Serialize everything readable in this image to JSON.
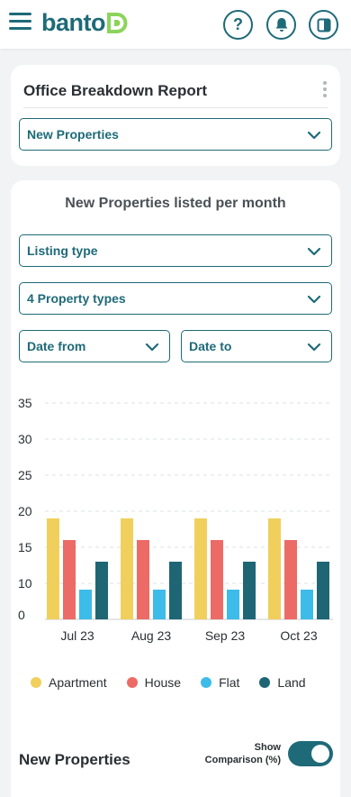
{
  "app": {
    "logo_text": "banto",
    "logo_mark": "D"
  },
  "header": {
    "help_label": "?"
  },
  "report_card": {
    "title": "Office Breakdown Report",
    "report_select": "New Properties"
  },
  "chart_card": {
    "title": "New Properties listed per month",
    "filters": {
      "listing_type": "Listing type",
      "property_types": "4 Property types",
      "date_from": "Date from",
      "date_to": "Date to"
    },
    "section_title": "New Properties",
    "toggle_label_line1": "Show",
    "toggle_label_line2": "Comparison (%)",
    "toggle_on": true
  },
  "colors": {
    "brand": "#1e6a78",
    "apartment": "#f1cf5c",
    "house": "#ec6b66",
    "flat": "#3dbbe9",
    "land": "#1f6675"
  },
  "chart_data": {
    "type": "bar",
    "categories": [
      "Jul 23",
      "Aug 23",
      "Sep 23",
      "Oct 23"
    ],
    "series": [
      {
        "name": "Apartment",
        "values": [
          19,
          19,
          19,
          19
        ]
      },
      {
        "name": "House",
        "values": [
          16,
          16,
          16,
          16
        ]
      },
      {
        "name": "Flat",
        "values": [
          8,
          8,
          8,
          8
        ]
      },
      {
        "name": "Land",
        "values": [
          13,
          13,
          13,
          13
        ]
      }
    ],
    "y_ticks": [
      0,
      10,
      15,
      20,
      25,
      30,
      35
    ],
    "ylim": [
      0,
      35
    ],
    "grid": true,
    "legend_position": "bottom",
    "title": "New Properties listed per month"
  }
}
